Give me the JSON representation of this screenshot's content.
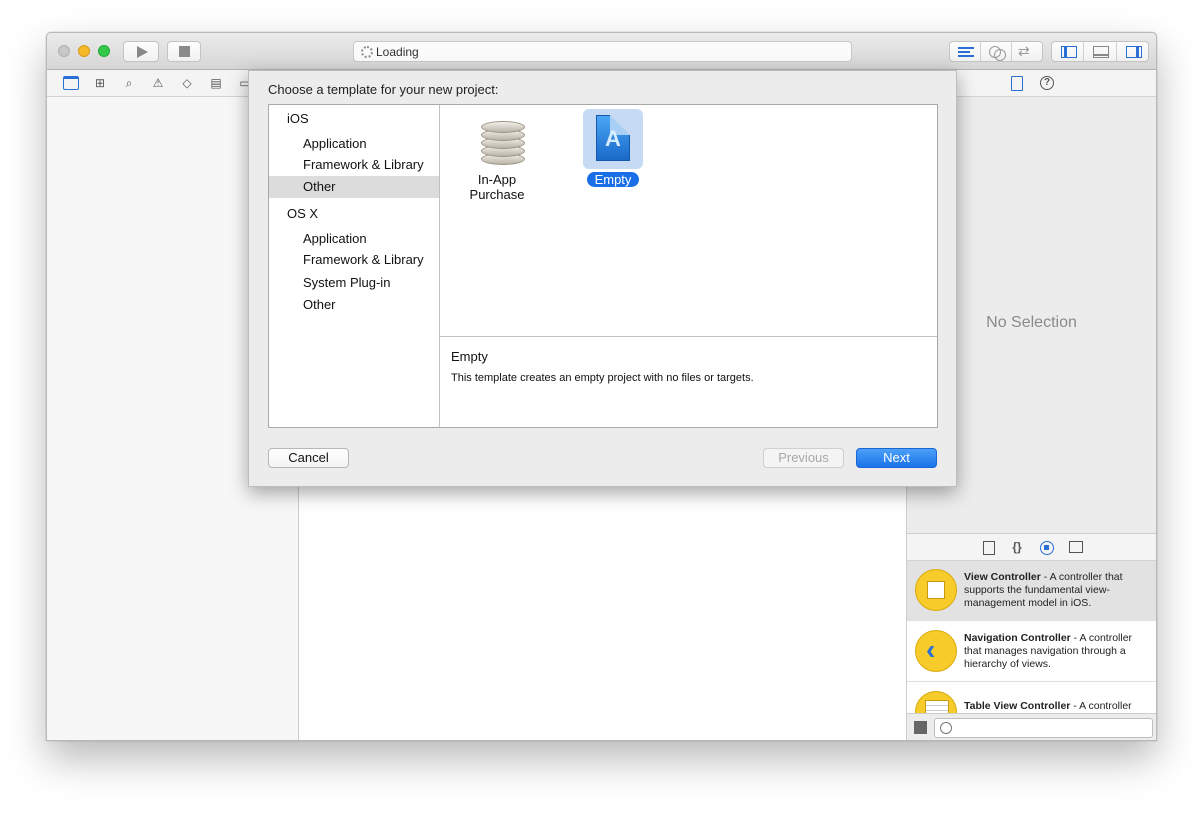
{
  "toolbar": {
    "activity_status": "Loading"
  },
  "inspector": {
    "no_selection": "No Selection"
  },
  "library": {
    "items": [
      {
        "name": "View Controller",
        "desc": " - A controller that supports the fundamental view-management model in iOS."
      },
      {
        "name": "Navigation Controller",
        "desc": " - A controller that manages navigation through a hierarchy of views."
      },
      {
        "name": "Table View Controller",
        "desc": " - A controller that manages a table view."
      }
    ]
  },
  "dialog": {
    "title": "Choose a template for your new project:",
    "categories": {
      "ios": "iOS",
      "ios_items": [
        "Application",
        "Framework & Library",
        "Other"
      ],
      "osx": "OS X",
      "osx_items": [
        "Application",
        "Framework & Library",
        "System Plug-in",
        "Other"
      ]
    },
    "selected_category": "iOS / Other",
    "templates": [
      {
        "label": "In-App Purchase",
        "icon": "coins-stack-icon"
      },
      {
        "label": "Empty",
        "icon": "empty-app-document-icon"
      }
    ],
    "selected_template": "Empty",
    "description": {
      "title": "Empty",
      "text": "This template creates an empty project with no files or targets."
    },
    "buttons": {
      "cancel": "Cancel",
      "previous": "Previous",
      "next": "Next"
    }
  },
  "colors": {
    "accent": "#1a6ee6",
    "selection_bg": "#c6dbf3",
    "library_icon": "#f7cb2a"
  }
}
